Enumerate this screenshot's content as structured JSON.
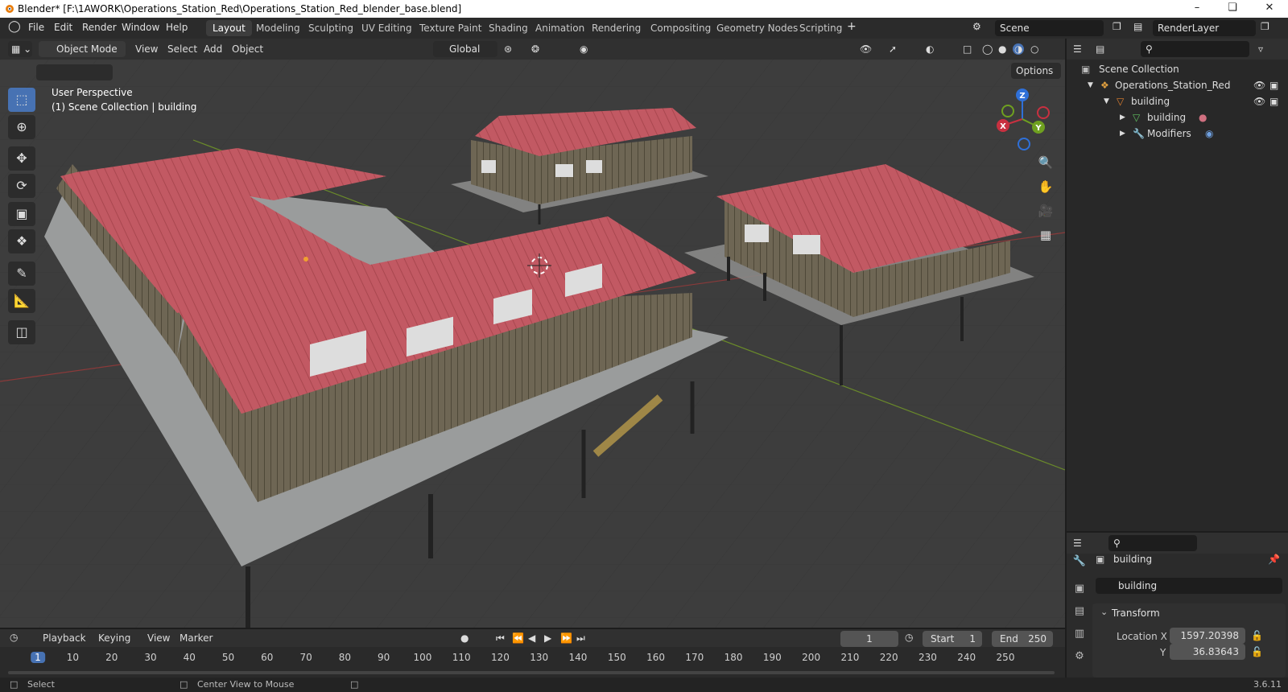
{
  "window": {
    "title": "Blender* [F:\\1AWORK\\Operations_Station_Red\\Operations_Station_Red_blender_base.blend]",
    "minimize_icon": "minimize-icon",
    "maximize_icon": "restore-icon",
    "close_icon": "close-icon"
  },
  "menu": [
    "File",
    "Edit",
    "Render",
    "Window",
    "Help"
  ],
  "workspaces": [
    "Layout",
    "Modeling",
    "Sculpting",
    "UV Editing",
    "Texture Paint",
    "Shading",
    "Animation",
    "Rendering",
    "Compositing",
    "Geometry Nodes",
    "Scripting"
  ],
  "active_workspace": "Layout",
  "scene": {
    "name": "Scene",
    "render_layer": "RenderLayer"
  },
  "viewport_header": {
    "mode": "Object Mode",
    "menus": [
      "View",
      "Select",
      "Add",
      "Object"
    ],
    "orientation": "Global",
    "options_label": "Options"
  },
  "viewport": {
    "perspective": "User Perspective",
    "collection_info": "(1) Scene Collection | building",
    "axis_labels": {
      "x": "X",
      "y": "Y",
      "z": "Z"
    }
  },
  "tools": [
    "select-box-icon",
    "cursor-icon",
    "move-icon",
    "rotate-icon",
    "scale-icon",
    "transform-icon",
    "annotate-icon",
    "measure-icon",
    "add-cube-icon"
  ],
  "outliner": {
    "root": "Scene Collection",
    "items": [
      {
        "label": "Operations_Station_Red",
        "icon": "collection-icon"
      },
      {
        "label": "building",
        "icon": "object-icon"
      },
      {
        "label": "building",
        "icon": "mesh-icon"
      },
      {
        "label": "Modifiers",
        "icon": "wrench-icon"
      }
    ]
  },
  "properties": {
    "object_name": "building",
    "data_name": "building",
    "section": "Transform",
    "location_x_label": "Location X",
    "location_x": "1597.20398",
    "location_y_label": "Y",
    "location_y": "36.83643"
  },
  "timeline": {
    "menus": [
      "Playback",
      "Keying",
      "View",
      "Marker"
    ],
    "current_frame": "1",
    "start_label": "Start",
    "start": "1",
    "end_label": "End",
    "end": "250",
    "frame_ticks": [
      "1",
      "10",
      "20",
      "30",
      "40",
      "50",
      "60",
      "70",
      "80",
      "90",
      "100",
      "110",
      "120",
      "130",
      "140",
      "150",
      "160",
      "170",
      "180",
      "190",
      "200",
      "210",
      "220",
      "230",
      "240",
      "250"
    ]
  },
  "statusbar": {
    "select": "Select",
    "center_view": "Center View to Mouse",
    "version": "3.6.11"
  },
  "colors": {
    "roof": "#c4545e",
    "wall": "#6b6352",
    "accent": "#4772b3",
    "grid": "#3e3e3e"
  }
}
